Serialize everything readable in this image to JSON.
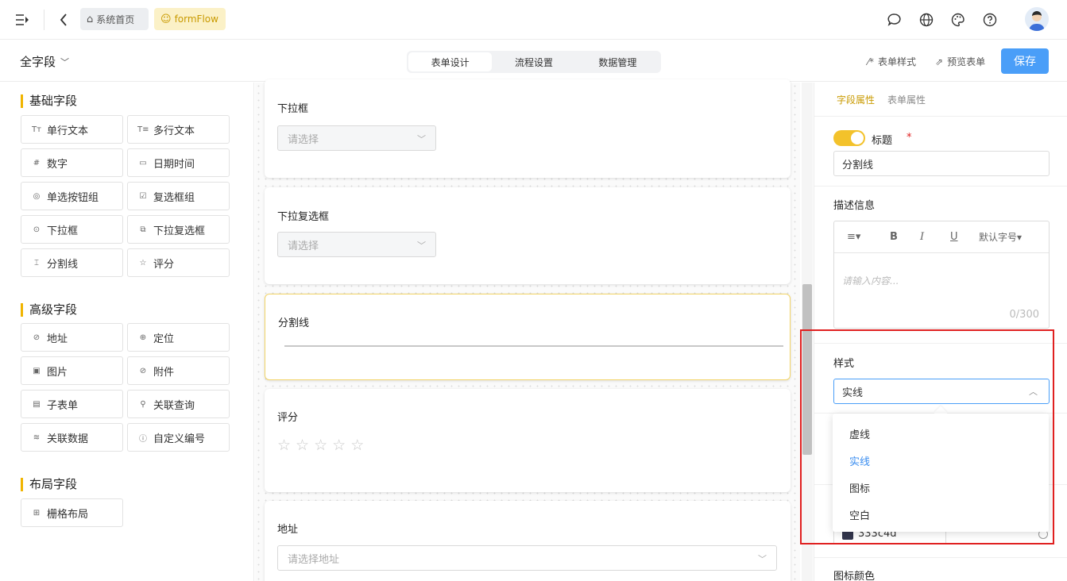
{
  "topbar": {
    "breadcrumb_home": "系统首页",
    "breadcrumb_flow": "formFlow"
  },
  "subbar": {
    "field_filter": "全字段",
    "tabs": [
      "表单设计",
      "流程设置",
      "数据管理"
    ],
    "form_style": "表单样式",
    "preview": "预览表单",
    "save": "保存"
  },
  "left": {
    "basic_title": "基础字段",
    "basic": [
      {
        "icon": "Tт",
        "label": "单行文本"
      },
      {
        "icon": "T≡",
        "label": "多行文本"
      },
      {
        "icon": "#",
        "label": "数字"
      },
      {
        "icon": "▭",
        "label": "日期时间"
      },
      {
        "icon": "◎",
        "label": "单选按钮组"
      },
      {
        "icon": "☑",
        "label": "复选框组"
      },
      {
        "icon": "⊙",
        "label": "下拉框"
      },
      {
        "icon": "⧉",
        "label": "下拉复选框"
      },
      {
        "icon": "⌶",
        "label": "分割线"
      },
      {
        "icon": "☆",
        "label": "评分"
      }
    ],
    "advanced_title": "高级字段",
    "advanced": [
      {
        "icon": "⊘",
        "label": "地址"
      },
      {
        "icon": "⊕",
        "label": "定位"
      },
      {
        "icon": "▣",
        "label": "图片"
      },
      {
        "icon": "⊘",
        "label": "附件"
      },
      {
        "icon": "▤",
        "label": "子表单"
      },
      {
        "icon": "⚲",
        "label": "关联查询"
      },
      {
        "icon": "≋",
        "label": "关联数据"
      },
      {
        "icon": "ⓘ",
        "label": "自定义编号"
      }
    ],
    "layout_title": "布局字段",
    "layout": [
      {
        "icon": "⊞",
        "label": "栅格布局"
      }
    ]
  },
  "canvas": {
    "dropdown_label": "下拉框",
    "dropdown_placeholder": "请选择",
    "multi_label": "下拉复选框",
    "multi_placeholder": "请选择",
    "divider_label": "分割线",
    "rating_label": "评分",
    "address_label": "地址",
    "address_placeholder": "请选择地址"
  },
  "right": {
    "tab_field": "字段属性",
    "tab_form": "表单属性",
    "title_label": "标题",
    "required_mark": "*",
    "title_value": "分割线",
    "desc_label": "描述信息",
    "font_size": "默认字号",
    "desc_placeholder": "请输入内容...",
    "char_count": "0/300",
    "style_label": "样式",
    "style_value": "实线",
    "style_options": [
      "虚线",
      "实线",
      "图标",
      "空白"
    ],
    "color_value": "333c4d",
    "icon_color_label": "图标颜色"
  },
  "colors": {
    "accent": "#f0b400",
    "primary": "#4a9ef8",
    "highlight": "#e02020"
  }
}
